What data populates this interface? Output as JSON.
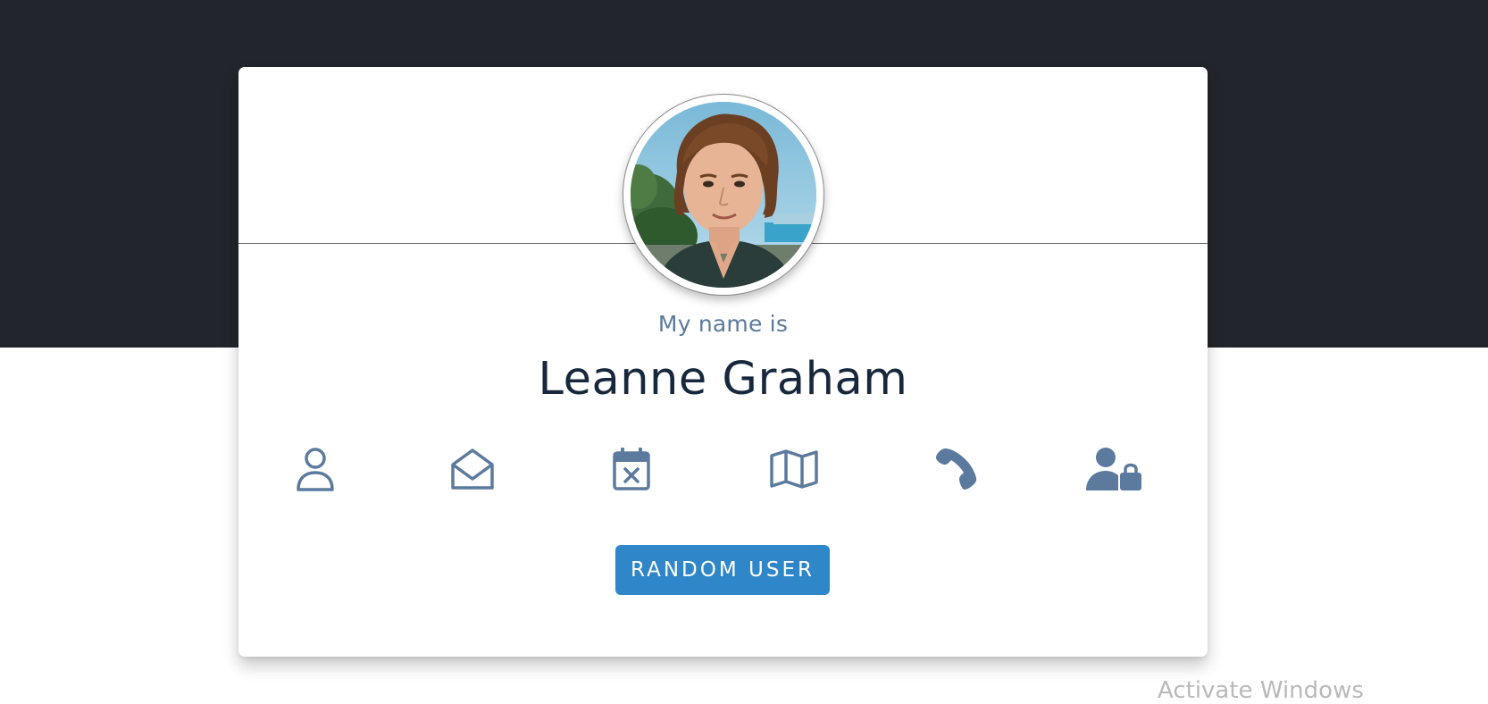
{
  "profile": {
    "label": "My name is",
    "value": "Leanne Graham"
  },
  "icons": [
    {
      "name": "user-icon"
    },
    {
      "name": "envelope-open-icon"
    },
    {
      "name": "calendar-x-icon"
    },
    {
      "name": "map-icon"
    },
    {
      "name": "phone-icon"
    },
    {
      "name": "user-lock-icon"
    }
  ],
  "actions": {
    "random_button": "RANDOM USER"
  },
  "watermark": "Activate Windows",
  "colors": {
    "header_bg": "#22262c",
    "icon": "#5b7a9d",
    "button": "#2f86c8",
    "name_text": "#17283c"
  }
}
